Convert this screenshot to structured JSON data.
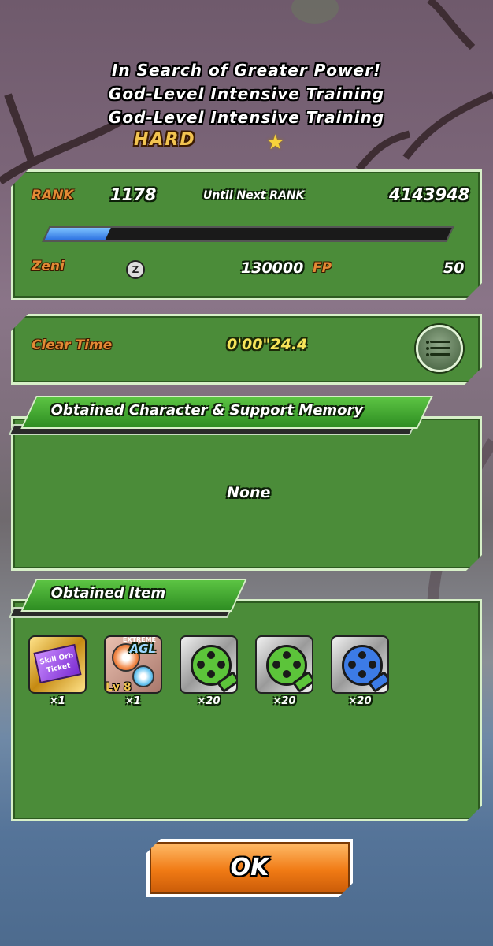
{
  "header": {
    "line1": "In Search of Greater Power!",
    "line2": "God-Level Intensive Training",
    "line3": "God-Level Intensive Training",
    "difficulty": "HARD"
  },
  "rank_panel": {
    "rank_label": "RANK",
    "rank_value": "1178",
    "next_label": "Until Next RANK",
    "next_value": "4143948",
    "progress_fraction": 0.15,
    "zeni_label": "Zeni",
    "zeni_value": "130000",
    "fp_label": "FP",
    "fp_value": "50"
  },
  "clear_panel": {
    "label": "Clear Time",
    "value": "0'00\"24.4"
  },
  "character_section": {
    "title": "Obtained Character & Support Memory",
    "value": "None"
  },
  "item_section": {
    "title": "Obtained Item",
    "items": [
      {
        "name": "skill-orb-ticket",
        "ticket_text": "Skill Orb Ticket",
        "count": "×1"
      },
      {
        "name": "extreme-agl-skill-orbs",
        "type_small": "EXTREME",
        "type_big": "AGL",
        "level": "Lv 8",
        "count": "×1"
      },
      {
        "name": "green-film-reel",
        "count": "×20"
      },
      {
        "name": "green-film-reel",
        "count": "×20"
      },
      {
        "name": "blue-film-reel",
        "count": "×20"
      }
    ]
  },
  "ok_button": {
    "label": "OK"
  },
  "colors": {
    "panel_green": "#4b8c39",
    "label_orange": "#e38a35",
    "value_yellow": "#f6e45a",
    "button_orange": "#f07a14"
  }
}
